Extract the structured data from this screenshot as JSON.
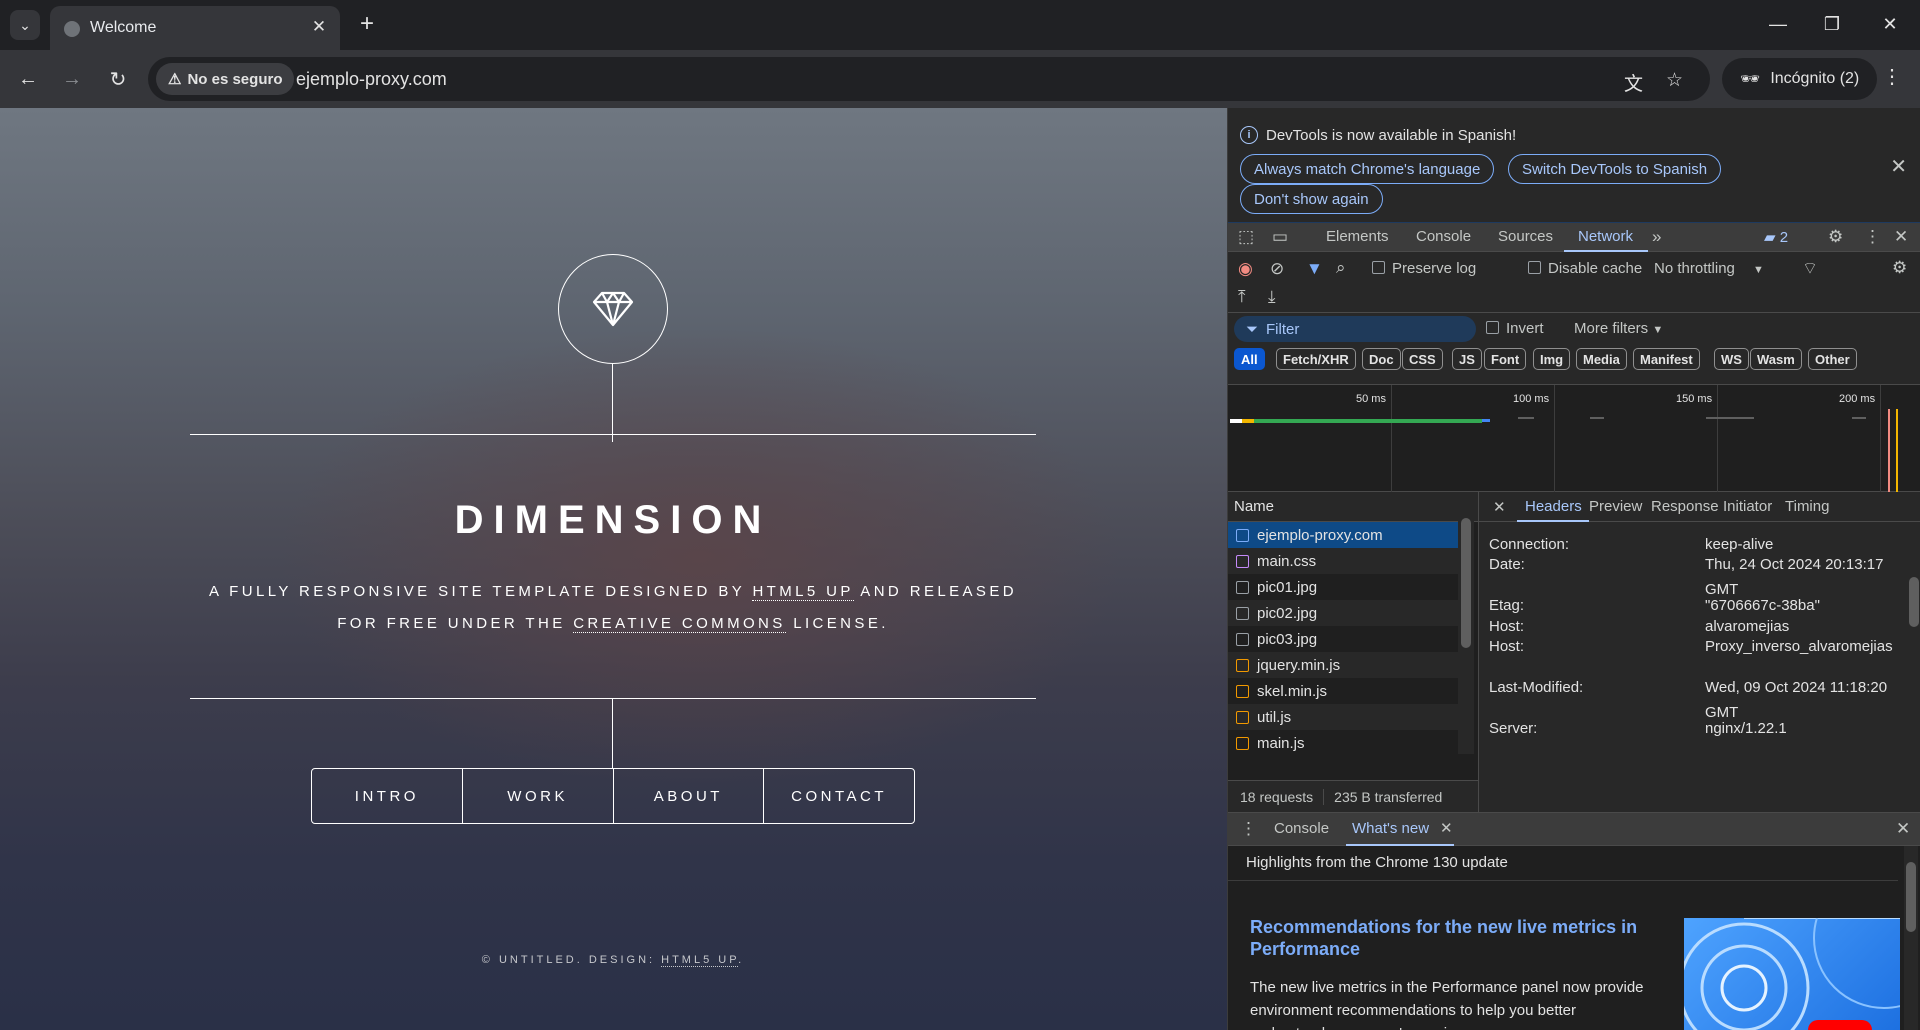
{
  "browser": {
    "tab_title": "Welcome",
    "security_label": "No es seguro",
    "url": "ejemplo-proxy.com",
    "incognito_label": "Incógnito (2)"
  },
  "site": {
    "title": "DIMENSION",
    "desc_prefix": "A FULLY RESPONSIVE SITE TEMPLATE DESIGNED BY ",
    "desc_link1": "HTML5 UP",
    "desc_middle": " AND RELEASED",
    "desc_line2_prefix": "FOR FREE UNDER THE ",
    "desc_link2": "CREATIVE COMMONS",
    "desc_suffix": " LICENSE.",
    "nav": [
      "INTRO",
      "WORK",
      "ABOUT",
      "CONTACT"
    ],
    "footer_prefix": "© UNTITLED. DESIGN: ",
    "footer_link": "HTML5 UP",
    "footer_suffix": "."
  },
  "devtools": {
    "info_message": "DevTools is now available in Spanish!",
    "btn_match": "Always match Chrome's language",
    "btn_switch": "Switch DevTools to Spanish",
    "btn_dont_show": "Don't show again",
    "tabs": [
      "Elements",
      "Console",
      "Sources",
      "Network"
    ],
    "issues_count": "2",
    "preserve_log": "Preserve log",
    "disable_cache": "Disable cache",
    "throttling": "No throttling",
    "filter_placeholder": "Filter",
    "invert": "Invert",
    "more_filters": "More filters",
    "type_filters": [
      "All",
      "Fetch/XHR",
      "Doc",
      "CSS",
      "JS",
      "Font",
      "Img",
      "Media",
      "Manifest",
      "WS",
      "Wasm",
      "Other"
    ],
    "timeline_labels": [
      "50 ms",
      "100 ms",
      "150 ms",
      "200 ms"
    ],
    "name_header": "Name",
    "requests": [
      {
        "name": "ejemplo-proxy.com",
        "icon": "document-icon",
        "color": "#7cacf8"
      },
      {
        "name": "main.css",
        "icon": "stylesheet-icon",
        "color": "#c58af9"
      },
      {
        "name": "pic01.jpg",
        "icon": "image-icon",
        "color": "#9aa0a6"
      },
      {
        "name": "pic02.jpg",
        "icon": "image-icon",
        "color": "#9aa0a6"
      },
      {
        "name": "pic03.jpg",
        "icon": "image-icon",
        "color": "#9aa0a6"
      },
      {
        "name": "jquery.min.js",
        "icon": "script-icon",
        "color": "#f29900"
      },
      {
        "name": "skel.min.js",
        "icon": "script-icon",
        "color": "#f29900"
      },
      {
        "name": "util.js",
        "icon": "script-icon",
        "color": "#f29900"
      },
      {
        "name": "main.js",
        "icon": "script-icon",
        "color": "#f29900"
      }
    ],
    "summary_requests": "18 requests",
    "summary_transferred": "235 B transferred",
    "detail_tabs": [
      "Headers",
      "Preview",
      "Response",
      "Initiator",
      "Timing"
    ],
    "headers": [
      {
        "key": "Connection:",
        "value": "keep-alive"
      },
      {
        "key": "Date:",
        "value": "Thu, 24 Oct 2024 20:13:17 GMT"
      },
      {
        "key": "Etag:",
        "value": "\"6706667c-38ba\""
      },
      {
        "key": "Host:",
        "value": "alvaromejias"
      },
      {
        "key": "Host:",
        "value": "Proxy_inverso_alvaromejias"
      },
      {
        "key": "Last-Modified:",
        "value": "Wed, 09 Oct 2024 11:18:20 GMT"
      },
      {
        "key": "Server:",
        "value": "nginx/1.22.1"
      }
    ],
    "drawer_tabs": [
      "Console",
      "What's new"
    ],
    "highlights": "Highlights from the Chrome 130 update",
    "rec_title": "Recommendations for the new live metrics in Performance",
    "rec_desc": "The new live metrics in the Performance panel now provide environment recommendations to help you better understand your users' experience."
  },
  "colors": {
    "accent": "#a8c7fa",
    "selected_row": "#0e4a87",
    "chip_selected": "#0b57d0"
  }
}
